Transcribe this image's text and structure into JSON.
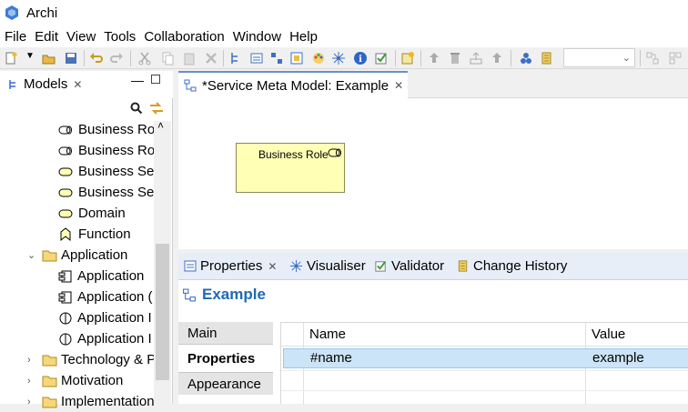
{
  "app": {
    "title": "Archi"
  },
  "menu": [
    "File",
    "Edit",
    "View",
    "Tools",
    "Collaboration",
    "Window",
    "Help"
  ],
  "models_panel": {
    "tab_label": "Models",
    "tree": [
      {
        "label": "Business Rol",
        "icon": "business-role-icon",
        "indent": 2
      },
      {
        "label": "Business Rol",
        "icon": "business-role-icon",
        "indent": 2
      },
      {
        "label": "Business Serv",
        "icon": "business-service-icon",
        "indent": 2
      },
      {
        "label": "Business Serv",
        "icon": "business-service-icon",
        "indent": 2
      },
      {
        "label": "Domain",
        "icon": "domain-icon",
        "indent": 2
      },
      {
        "label": "Function",
        "icon": "function-icon",
        "indent": 2
      },
      {
        "label": "Application",
        "icon": "folder-icon",
        "indent": 1,
        "expanded": true
      },
      {
        "label": "Application",
        "icon": "application-component-icon",
        "indent": 2
      },
      {
        "label": "Application (",
        "icon": "application-component-icon",
        "indent": 2
      },
      {
        "label": "Application I",
        "icon": "application-interface-icon",
        "indent": 2
      },
      {
        "label": "Application I",
        "icon": "application-interface-icon",
        "indent": 2
      },
      {
        "label": "Technology & P",
        "icon": "folder-icon",
        "indent": 1,
        "expanded": false
      },
      {
        "label": "Motivation",
        "icon": "folder-icon",
        "indent": 1,
        "expanded": false
      },
      {
        "label": "Implementation",
        "icon": "folder-icon",
        "indent": 1,
        "expanded": false
      }
    ]
  },
  "editor": {
    "tab_label": "*Service Meta Model: Example",
    "element_label": "Business Role"
  },
  "properties_panel": {
    "tabs": [
      "Properties",
      "Visualiser",
      "Validator",
      "Change History"
    ],
    "title": "Example",
    "side_tabs": [
      "Main",
      "Properties",
      "Appearance"
    ],
    "active_side_tab": "Properties",
    "columns": [
      "Name",
      "Value"
    ],
    "rows": [
      {
        "name": "#name",
        "value": "example"
      }
    ]
  },
  "colors": {
    "accent": "#1f6ab5",
    "element_fill": "#ffffb5",
    "selection": "#cce4f7"
  }
}
